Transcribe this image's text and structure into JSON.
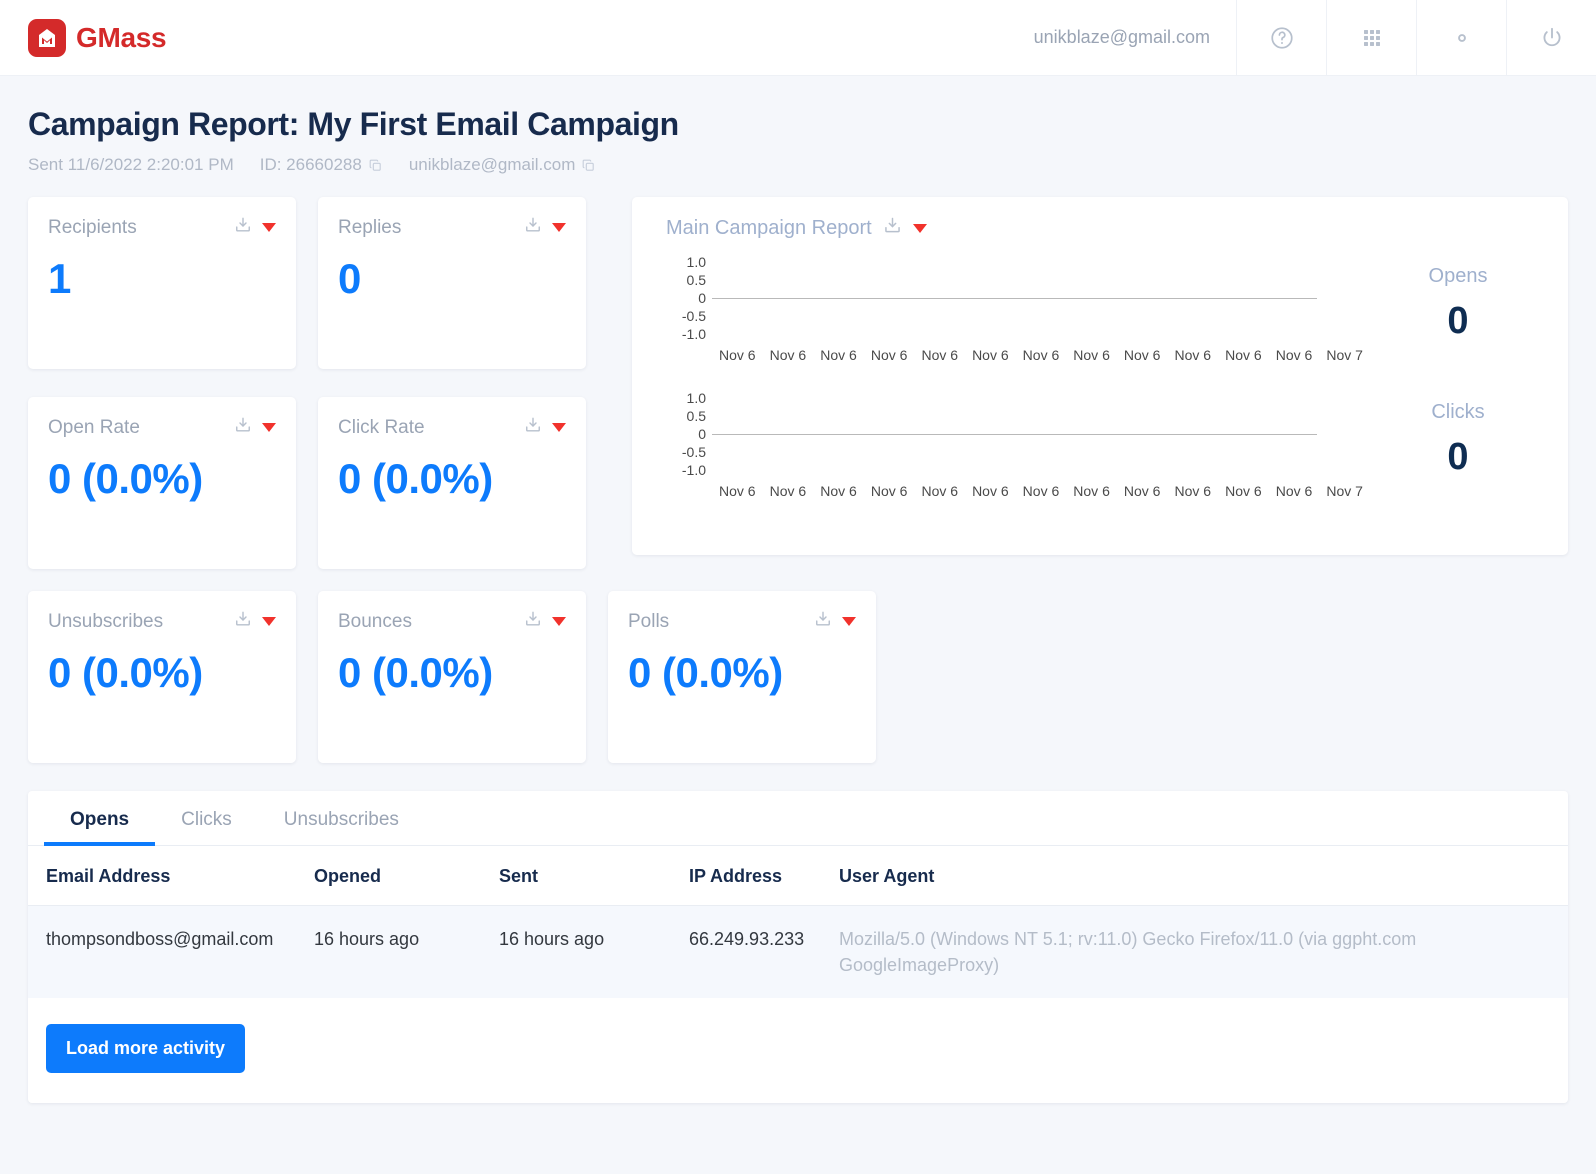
{
  "header": {
    "brand": "GMass",
    "brand_icon": "gmass-logo-icon",
    "user_email": "unikblaze@gmail.com",
    "icons": [
      {
        "name": "help-icon",
        "label": "?"
      },
      {
        "name": "apps-grid-icon",
        "label": ""
      },
      {
        "name": "settings-gear-icon",
        "label": ""
      },
      {
        "name": "power-icon",
        "label": ""
      }
    ]
  },
  "page": {
    "title": "Campaign Report: My First Email Campaign",
    "sent_label": "Sent 11/6/2022 2:20:01 PM",
    "id_label": "ID: 26660288",
    "account_email": "unikblaze@gmail.com"
  },
  "metrics": [
    {
      "label": "Recipients",
      "value": "1"
    },
    {
      "label": "Replies",
      "value": "0"
    },
    {
      "label": "Open Rate",
      "value": "0 (0.0%)"
    },
    {
      "label": "Click Rate",
      "value": "0 (0.0%)"
    },
    {
      "label": "Unsubscribes",
      "value": "0 (0.0%)"
    },
    {
      "label": "Bounces",
      "value": "0 (0.0%)"
    },
    {
      "label": "Polls",
      "value": "0 (0.0%)"
    }
  ],
  "report": {
    "title": "Main Campaign Report",
    "opens_label": "Opens",
    "opens_value": "0",
    "clicks_label": "Clicks",
    "clicks_value": "0"
  },
  "chart_data": [
    {
      "type": "line",
      "title": "Main Campaign Report",
      "series_name": "Opens",
      "categories": [
        "Nov 6",
        "Nov 6",
        "Nov 6",
        "Nov 6",
        "Nov 6",
        "Nov 6",
        "Nov 6",
        "Nov 6",
        "Nov 6",
        "Nov 6",
        "Nov 6",
        "Nov 6",
        "Nov 7"
      ],
      "values": [
        0,
        0,
        0,
        0,
        0,
        0,
        0,
        0,
        0,
        0,
        0,
        0,
        0
      ],
      "ytick_labels": [
        "1.0",
        "0.5",
        "0",
        "-0.5",
        "-1.0"
      ],
      "ylim": [
        -1.0,
        1.0
      ],
      "xlabel": "",
      "ylabel": "",
      "grid": false,
      "legend": "none",
      "total_label": "Opens",
      "total_value": "0"
    },
    {
      "type": "line",
      "title": "Main Campaign Report",
      "series_name": "Clicks",
      "categories": [
        "Nov 6",
        "Nov 6",
        "Nov 6",
        "Nov 6",
        "Nov 6",
        "Nov 6",
        "Nov 6",
        "Nov 6",
        "Nov 6",
        "Nov 6",
        "Nov 6",
        "Nov 6",
        "Nov 7"
      ],
      "values": [
        0,
        0,
        0,
        0,
        0,
        0,
        0,
        0,
        0,
        0,
        0,
        0,
        0
      ],
      "ytick_labels": [
        "1.0",
        "0.5",
        "0",
        "-0.5",
        "-1.0"
      ],
      "ylim": [
        -1.0,
        1.0
      ],
      "xlabel": "",
      "ylabel": "",
      "grid": false,
      "legend": "none",
      "total_label": "Clicks",
      "total_value": "0"
    }
  ],
  "activity": {
    "tabs": [
      {
        "label": "Opens",
        "active": true
      },
      {
        "label": "Clicks",
        "active": false
      },
      {
        "label": "Unsubscribes",
        "active": false
      }
    ],
    "columns": [
      "Email Address",
      "Opened",
      "Sent",
      "IP Address",
      "User Agent"
    ],
    "rows": [
      {
        "email": "thompsondboss@gmail.com",
        "opened": "16 hours ago",
        "sent": "16 hours ago",
        "ip": "66.249.93.233",
        "user_agent": "Mozilla/5.0 (Windows NT 5.1; rv:11.0) Gecko Firefox/11.0 (via ggpht.com GoogleImageProxy)"
      }
    ],
    "load_more_label": "Load more activity"
  },
  "colors": {
    "brand_red": "#d42a2a",
    "accent_blue": "#0d7bfc",
    "title_navy": "#172b4d",
    "muted": "#9aa4b4",
    "caret_red": "#f1322c",
    "page_bg": "#f5f7fb"
  }
}
